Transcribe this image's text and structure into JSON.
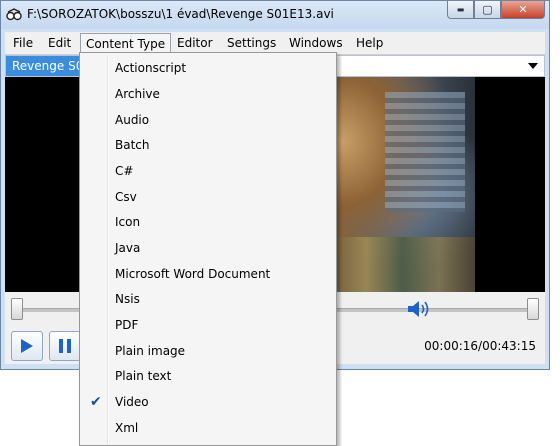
{
  "window": {
    "title": "F:\\SOROZATOK\\bosszu\\1 évad\\Revenge S01E13.avi",
    "controls": {
      "minimize": "▬",
      "maximize": "▢",
      "close": "✕"
    }
  },
  "menubar": {
    "items": [
      "File",
      "Edit",
      "Content Type",
      "Editor",
      "Settings",
      "Windows",
      "Help"
    ]
  },
  "tab": {
    "label": "Revenge S01E13.avi"
  },
  "player": {
    "time": "00:00:16/00:43:15",
    "play_icon": "play-icon",
    "pause_icon": "pause-icon",
    "volume_icon": "speaker-icon"
  },
  "content_type_menu": {
    "items": [
      {
        "label": "Actionscript",
        "checked": false
      },
      {
        "label": "Archive",
        "checked": false
      },
      {
        "label": "Audio",
        "checked": false
      },
      {
        "label": "Batch",
        "checked": false
      },
      {
        "label": "C#",
        "checked": false
      },
      {
        "label": "Csv",
        "checked": false
      },
      {
        "label": "Icon",
        "checked": false
      },
      {
        "label": "Java",
        "checked": false
      },
      {
        "label": "Microsoft Word Document",
        "checked": false
      },
      {
        "label": "Nsis",
        "checked": false
      },
      {
        "label": "PDF",
        "checked": false
      },
      {
        "label": "Plain image",
        "checked": false
      },
      {
        "label": "Plain text",
        "checked": false
      },
      {
        "label": "Video",
        "checked": true
      },
      {
        "label": "Xml",
        "checked": false
      }
    ],
    "check_glyph": "✔"
  },
  "colors": {
    "accent": "#3a8dde",
    "window_frame": "#cfe0f2",
    "close_button": "#c7402a"
  }
}
